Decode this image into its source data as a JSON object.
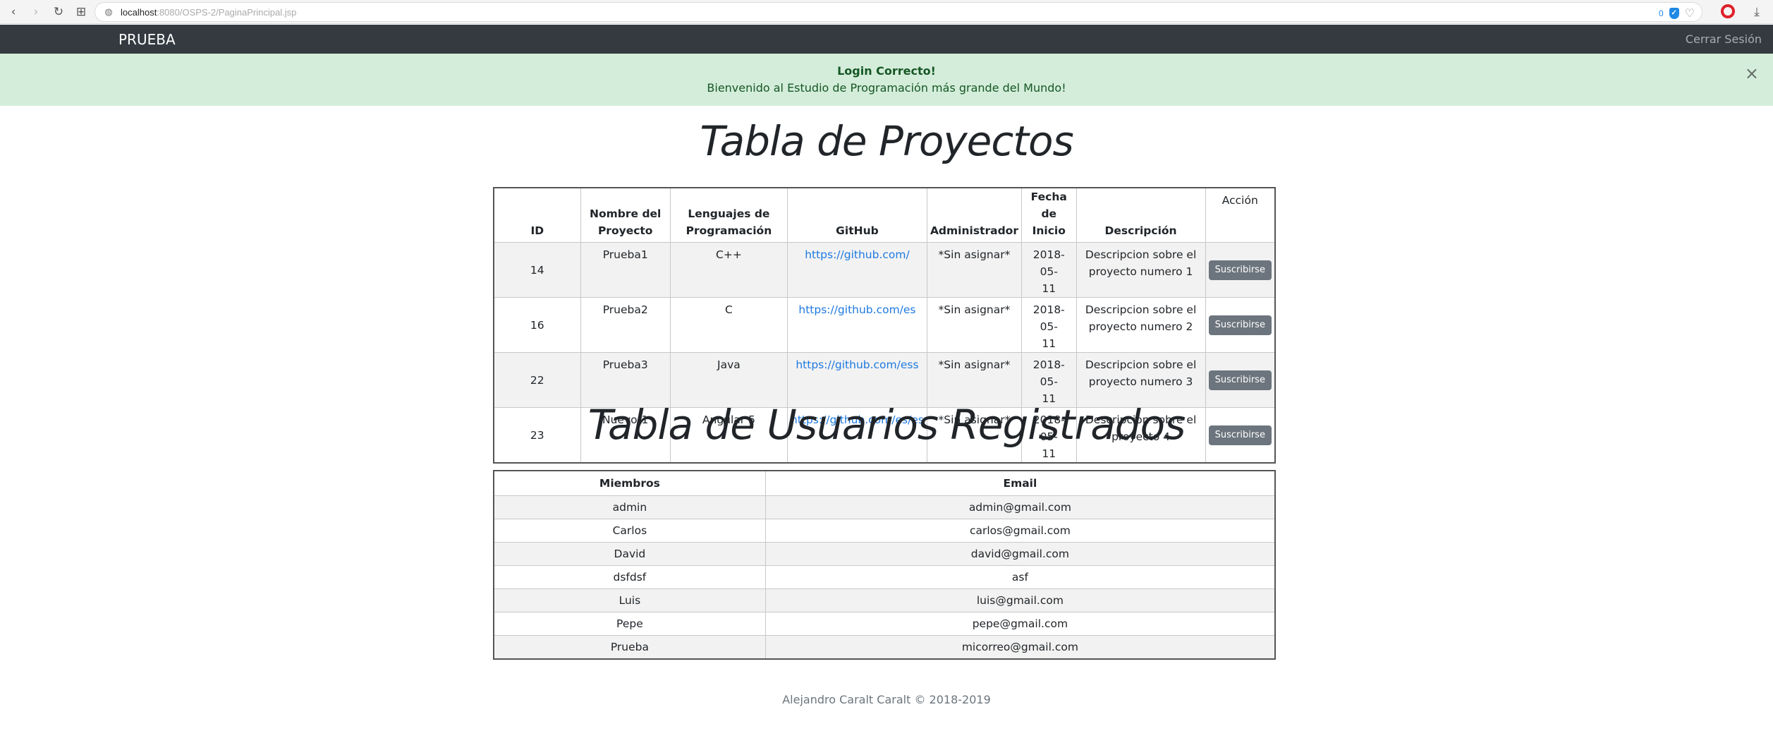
{
  "browser": {
    "url_host": "localhost",
    "url_rest": ":8080/OSPS-2/PaginaPrincipal.jsp",
    "shield_count": "0"
  },
  "navbar": {
    "brand": "PRUEBA",
    "logout_label": "Cerrar Sesión"
  },
  "alert": {
    "title": "Login Correcto!",
    "message": "Bienvenido al Estudio de Programación más grande del Mundo!",
    "close": "×"
  },
  "projects": {
    "title": "Tabla de Proyectos",
    "headers": {
      "id": "ID",
      "name_1": "Nombre del",
      "name_2": "Proyecto",
      "lang_1": "Lenguajes de",
      "lang_2": "Programación",
      "github": "GitHub",
      "admin": "Administrador",
      "date_1": "Fecha de",
      "date_2": "Inicio",
      "description": "Descripción",
      "action": "Acción"
    },
    "rows": [
      {
        "id": "14",
        "name": "Prueba1",
        "lang": "C++",
        "github": "https://github.com/",
        "admin": "*Sin asignar*",
        "date_1": "2018-05-",
        "date_2": "11",
        "desc_1": "Descripcion sobre el",
        "desc_2": "proyecto numero 1",
        "button": "Suscribirse"
      },
      {
        "id": "16",
        "name": "Prueba2",
        "lang": "C",
        "github": "https://github.com/es",
        "admin": "*Sin asignar*",
        "date_1": "2018-05-",
        "date_2": "11",
        "desc_1": "Descripcion sobre el",
        "desc_2": "proyecto numero 2",
        "button": "Suscribirse"
      },
      {
        "id": "22",
        "name": "Prueba3",
        "lang": "Java",
        "github": "https://github.com/ess",
        "admin": "*Sin asignar*",
        "date_1": "2018-05-",
        "date_2": "11",
        "desc_1": "Descripcion sobre el",
        "desc_2": "proyecto numero 3",
        "button": "Suscribirse"
      },
      {
        "id": "23",
        "name": "Nuevo-1",
        "lang": "Angular 5",
        "github": "https://github.com/es/es",
        "admin": "*Sin asignar*",
        "date_1": "2018-05-",
        "date_2": "11",
        "desc_1": "Descripcion sobre el",
        "desc_2": "proyecto 4",
        "button": "Suscribirse"
      }
    ]
  },
  "users": {
    "title": "Tabla de Usuarios Registrados",
    "headers": {
      "members": "Miembros",
      "email": "Email"
    },
    "rows": [
      {
        "member": "admin",
        "email": "admin@gmail.com"
      },
      {
        "member": "Carlos",
        "email": "carlos@gmail.com"
      },
      {
        "member": "David",
        "email": "david@gmail.com"
      },
      {
        "member": "dsfdsf",
        "email": "asf"
      },
      {
        "member": "Luis",
        "email": "luis@gmail.com"
      },
      {
        "member": "Pepe",
        "email": "pepe@gmail.com"
      },
      {
        "member": "Prueba",
        "email": "micorreo@gmail.com"
      }
    ]
  },
  "footer": {
    "text": "Alejandro Caralt Caralt © 2018-2019"
  }
}
